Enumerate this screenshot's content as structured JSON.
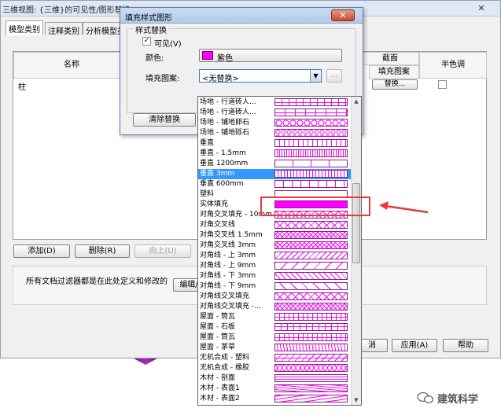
{
  "background_window": {
    "title": "三维视图: {三维}的可见性/图形替换",
    "close_glyph": "✕",
    "tabs": [
      "模型类别",
      "注释类别",
      "分析模型类"
    ],
    "grid": {
      "col_name": "名称",
      "col_surface_group": "截面",
      "col_fill_pattern": "填充图案",
      "col_halftone": "半色调",
      "row_name": "柱",
      "row_replace": "替换..."
    },
    "buttons": {
      "add": "添加(D)",
      "delete": "删除(R)",
      "up": "向上(U)",
      "cancel_fragment": "消",
      "apply": "应用(A)",
      "help": "帮助"
    },
    "filter_note": "所有文档过滤器都是在此处定义和修改的",
    "edit_button": "编辑/"
  },
  "dialog": {
    "title": "填充样式图形",
    "close_glyph": "✕",
    "group_title": "样式替换",
    "visible_label": "可见(V)",
    "visible_checked": true,
    "color_label": "颜色:",
    "color_value": "紫色",
    "color_hex": "#ff00ff",
    "pattern_label": "填充图案:",
    "pattern_value": "<无替换>",
    "browse_button": "...",
    "clear_button": "清除替换"
  },
  "dropdown": {
    "selected_index": 6,
    "items": [
      {
        "label": "场地 - 行道砖人...",
        "pattern": "brick"
      },
      {
        "label": "场地 - 行道砖人...",
        "pattern": "brick2"
      },
      {
        "label": "场地 - 铺地卵石",
        "pattern": "cobble"
      },
      {
        "label": "场地 - 铺地砾石",
        "pattern": "gravel"
      },
      {
        "label": "垂直",
        "pattern": "vert"
      },
      {
        "label": "垂直 - 1.5mm",
        "pattern": "vert-fine"
      },
      {
        "label": "垂直 1200mm",
        "pattern": "vert-wide"
      },
      {
        "label": "垂直 3mm",
        "pattern": "vert-med"
      },
      {
        "label": "垂直 600mm",
        "pattern": "vert-600"
      },
      {
        "label": "塑料",
        "pattern": "empty"
      },
      {
        "label": "实体填充",
        "pattern": "solid"
      },
      {
        "label": "对角交叉填充 - 10mm",
        "pattern": "diag-cross"
      },
      {
        "label": "对角交叉线",
        "pattern": "diag-cross"
      },
      {
        "label": "对角交叉线 1.5mm",
        "pattern": "diag-cross-fine"
      },
      {
        "label": "对角交叉线 3mm",
        "pattern": "diag-cross-fine"
      },
      {
        "label": "对角线 - 上 3mm",
        "pattern": "diag-up"
      },
      {
        "label": "对角线 - 上 9mm",
        "pattern": "diag-up-wide"
      },
      {
        "label": "对角线 - 下 3mm",
        "pattern": "diag-down"
      },
      {
        "label": "对角线 - 下 9mm",
        "pattern": "diag-down-wide"
      },
      {
        "label": "对角线交叉填充",
        "pattern": "diag-cross"
      },
      {
        "label": "对角线交叉填充 -...",
        "pattern": "diag-cross-fine"
      },
      {
        "label": "屋面 - 筒瓦",
        "pattern": "roof-tile"
      },
      {
        "label": "屋面 - 石板",
        "pattern": "roof-slate"
      },
      {
        "label": "屋面 - 筒瓦",
        "pattern": "roof-tile"
      },
      {
        "label": "屋面 - 茅草",
        "pattern": "thatch"
      },
      {
        "label": "无机合成 - 塑料",
        "pattern": "plastic"
      },
      {
        "label": "无机合成 - 橡胶",
        "pattern": "rubber"
      },
      {
        "label": "木材 - 剖面",
        "pattern": "wood-sec"
      },
      {
        "label": "木材 - 表面1",
        "pattern": "wood-s1"
      },
      {
        "label": "木材 - 表面2",
        "pattern": "wood-s2"
      }
    ]
  },
  "watermark": {
    "text": "建筑科学"
  },
  "colors": {
    "accent_magenta": "#ff00ff",
    "selection_blue": "#3399ff",
    "annotation_red": "#e8383d"
  }
}
